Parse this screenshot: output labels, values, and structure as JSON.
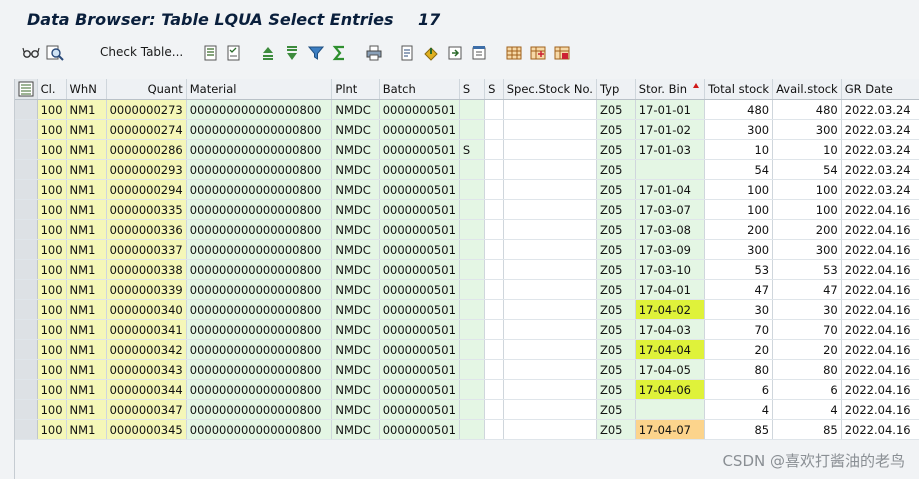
{
  "title": {
    "text": "Data Browser: Table LQUA Select Entries",
    "count": "17"
  },
  "toolbar": {
    "check_table_label": "Check Table...",
    "icons": [
      "glasses-icon",
      "find-icon",
      "details-icon",
      "checklist-icon",
      "sort-ascending-icon",
      "sort-descending-icon",
      "filter-icon",
      "sum-icon",
      "print-icon",
      "export-icon",
      "spreadsheet-icon",
      "word-processing-icon",
      "local-file-icon",
      "layout-grid-icon",
      "choose-layout-icon",
      "save-layout-icon"
    ]
  },
  "table": {
    "columns": [
      "Cl.",
      "WhN",
      "Quant",
      "Material",
      "Plnt",
      "Batch",
      "S",
      "S",
      "Spec.Stock No.",
      "Typ",
      "Stor. Bin",
      "Total stock",
      "Avail.stock",
      "GR Date"
    ],
    "rows": [
      [
        "100",
        "NM1",
        "0000000273",
        "000000000000000800",
        "NMDC",
        "0000000501",
        "",
        "",
        "",
        "Z05",
        "17-01-01",
        "480",
        "480",
        "2022.03.24"
      ],
      [
        "100",
        "NM1",
        "0000000274",
        "000000000000000800",
        "NMDC",
        "0000000501",
        "",
        "",
        "",
        "Z05",
        "17-01-02",
        "300",
        "300",
        "2022.03.24"
      ],
      [
        "100",
        "NM1",
        "0000000286",
        "000000000000000800",
        "NMDC",
        "0000000501",
        "S",
        "",
        "",
        "Z05",
        "17-01-03",
        "10",
        "10",
        "2022.03.24"
      ],
      [
        "100",
        "NM1",
        "0000000293",
        "000000000000000800",
        "NMDC",
        "0000000501",
        "",
        "",
        "",
        "Z05",
        "",
        "54",
        "54",
        "2022.03.24"
      ],
      [
        "100",
        "NM1",
        "0000000294",
        "000000000000000800",
        "NMDC",
        "0000000501",
        "",
        "",
        "",
        "Z05",
        "17-01-04",
        "100",
        "100",
        "2022.03.24"
      ],
      [
        "100",
        "NM1",
        "0000000335",
        "000000000000000800",
        "NMDC",
        "0000000501",
        "",
        "",
        "",
        "Z05",
        "17-03-07",
        "100",
        "100",
        "2022.04.16"
      ],
      [
        "100",
        "NM1",
        "0000000336",
        "000000000000000800",
        "NMDC",
        "0000000501",
        "",
        "",
        "",
        "Z05",
        "17-03-08",
        "200",
        "200",
        "2022.04.16"
      ],
      [
        "100",
        "NM1",
        "0000000337",
        "000000000000000800",
        "NMDC",
        "0000000501",
        "",
        "",
        "",
        "Z05",
        "17-03-09",
        "300",
        "300",
        "2022.04.16"
      ],
      [
        "100",
        "NM1",
        "0000000338",
        "000000000000000800",
        "NMDC",
        "0000000501",
        "",
        "",
        "",
        "Z05",
        "17-03-10",
        "53",
        "53",
        "2022.04.16"
      ],
      [
        "100",
        "NM1",
        "0000000339",
        "000000000000000800",
        "NMDC",
        "0000000501",
        "",
        "",
        "",
        "Z05",
        "17-04-01",
        "47",
        "47",
        "2022.04.16"
      ],
      [
        "100",
        "NM1",
        "0000000340",
        "000000000000000800",
        "NMDC",
        "0000000501",
        "",
        "",
        "",
        "Z05",
        "17-04-02",
        "30",
        "30",
        "2022.04.16"
      ],
      [
        "100",
        "NM1",
        "0000000341",
        "000000000000000800",
        "NMDC",
        "0000000501",
        "",
        "",
        "",
        "Z05",
        "17-04-03",
        "70",
        "70",
        "2022.04.16"
      ],
      [
        "100",
        "NM1",
        "0000000342",
        "000000000000000800",
        "NMDC",
        "0000000501",
        "",
        "",
        "",
        "Z05",
        "17-04-04",
        "20",
        "20",
        "2022.04.16"
      ],
      [
        "100",
        "NM1",
        "0000000343",
        "000000000000000800",
        "NMDC",
        "0000000501",
        "",
        "",
        "",
        "Z05",
        "17-04-05",
        "80",
        "80",
        "2022.04.16"
      ],
      [
        "100",
        "NM1",
        "0000000344",
        "000000000000000800",
        "NMDC",
        "0000000501",
        "",
        "",
        "",
        "Z05",
        "17-04-06",
        "6",
        "6",
        "2022.04.16"
      ],
      [
        "100",
        "NM1",
        "0000000347",
        "000000000000000800",
        "NMDC",
        "0000000501",
        "",
        "",
        "",
        "Z05",
        "",
        "4",
        "4",
        "2022.04.16"
      ],
      [
        "100",
        "NM1",
        "0000000345",
        "000000000000000800",
        "NMDC",
        "0000000501",
        "",
        "",
        "",
        "Z05",
        "17-04-07",
        "85",
        "85",
        "2022.04.16"
      ]
    ],
    "highlights": [
      {
        "row": 10,
        "col": 10,
        "color": "#dff23a"
      },
      {
        "row": 12,
        "col": 10,
        "color": "#dff23a"
      },
      {
        "row": 14,
        "col": 10,
        "color": "#dff23a"
      },
      {
        "row": 16,
        "col": 10,
        "color": "#fcd48c"
      }
    ],
    "sorted_column": "Stor. Bin",
    "colors": {
      "key_column": "#f5f7b8",
      "value_column": "#e4f6e4",
      "plain_column": "#ffffff"
    }
  },
  "watermark": "CSDN @喜欢打酱油的老鸟"
}
